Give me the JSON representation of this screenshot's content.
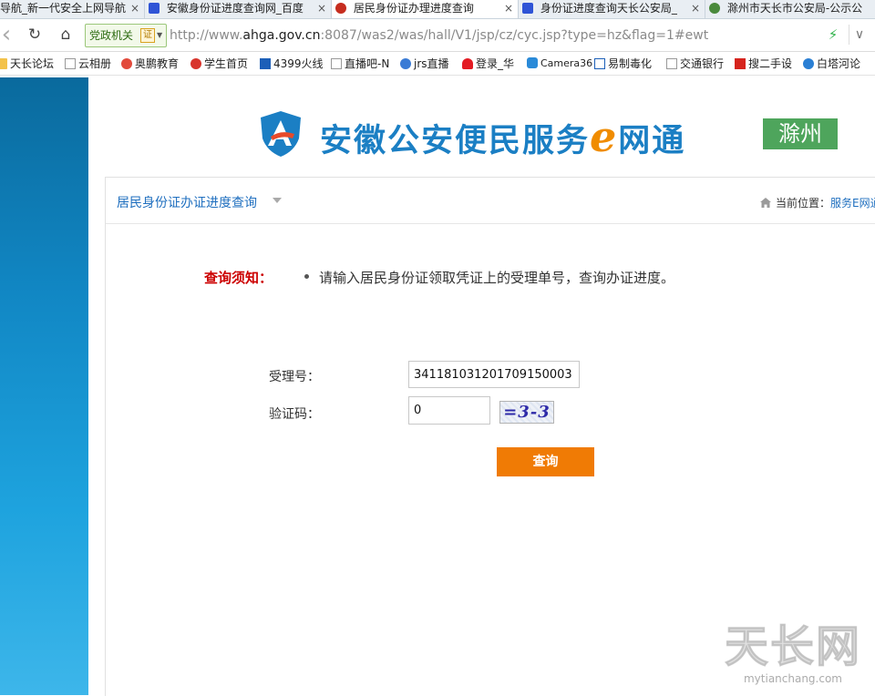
{
  "browser": {
    "tabs": [
      {
        "title": "导航_新一代安全上网导航",
        "close": "×"
      },
      {
        "title": "安徽身份证进度查询网_百度",
        "close": "×"
      },
      {
        "title": "居民身份证办理进度查询",
        "close": "×"
      },
      {
        "title": "身份证进度查询天长公安局_",
        "close": "×"
      },
      {
        "title": "滁州市天长市公安局-公示公",
        "close": ""
      }
    ],
    "nav": {
      "back": "‹",
      "reload": "↻",
      "home": "⌂",
      "mode_label": "党政机关",
      "cert_label": "证",
      "lightning": "⚡",
      "dropdown": "∨"
    },
    "url": {
      "prefix": "http://www.",
      "host": "ahga.gov.cn",
      "path": ":8087/was2/was/hall/V1/jsp/cz/cyc.jsp?type=hz&flag=1#ewt"
    },
    "bookmarks": [
      {
        "label": "天长论坛",
        "icon": "folder-icon"
      },
      {
        "label": "云相册",
        "icon": "page-icon"
      },
      {
        "label": "奥鹏教育",
        "icon": "page-icon"
      },
      {
        "label": "学生首页",
        "icon": "page-icon"
      },
      {
        "label": "4399火线",
        "icon": "page-icon"
      },
      {
        "label": "直播吧-N",
        "icon": "page-icon"
      },
      {
        "label": "jrs直播",
        "icon": "page-icon"
      },
      {
        "label": "登录_华",
        "icon": "page-icon"
      },
      {
        "label": "Camera36",
        "icon": "page-icon"
      },
      {
        "label": "易制毒化",
        "icon": "page-icon"
      },
      {
        "label": "交通银行",
        "icon": "page-icon"
      },
      {
        "label": "搜二手设",
        "icon": "page-icon"
      },
      {
        "label": "白塔河论",
        "icon": "page-icon"
      }
    ]
  },
  "header": {
    "title_part1": "安徽公安便民服务",
    "title_e": "e",
    "title_part2": "网通",
    "city": "滁州"
  },
  "panel": {
    "title": "居民身份证办证进度查询",
    "location_label": "当前位置：",
    "location_link": "服务E网通"
  },
  "notice": {
    "label": "查询须知：",
    "text": "请输入居民身份证领取凭证上的受理单号，查询办证进度。"
  },
  "form": {
    "accept_label": "受理号：",
    "accept_value": "341181031201709150003",
    "captcha_label": "验证码：",
    "captcha_value": "0",
    "captcha_image_text": "=3-3",
    "submit_label": "查询"
  },
  "watermark": {
    "main": "天长网",
    "sub": "mytianchang.com"
  },
  "colors": {
    "brand_blue": "#1b7fc4",
    "accent_orange": "#f07b05",
    "city_green": "#4ea55c",
    "notice_red": "#cc0000",
    "sidebar_blue": "#1187c4"
  }
}
